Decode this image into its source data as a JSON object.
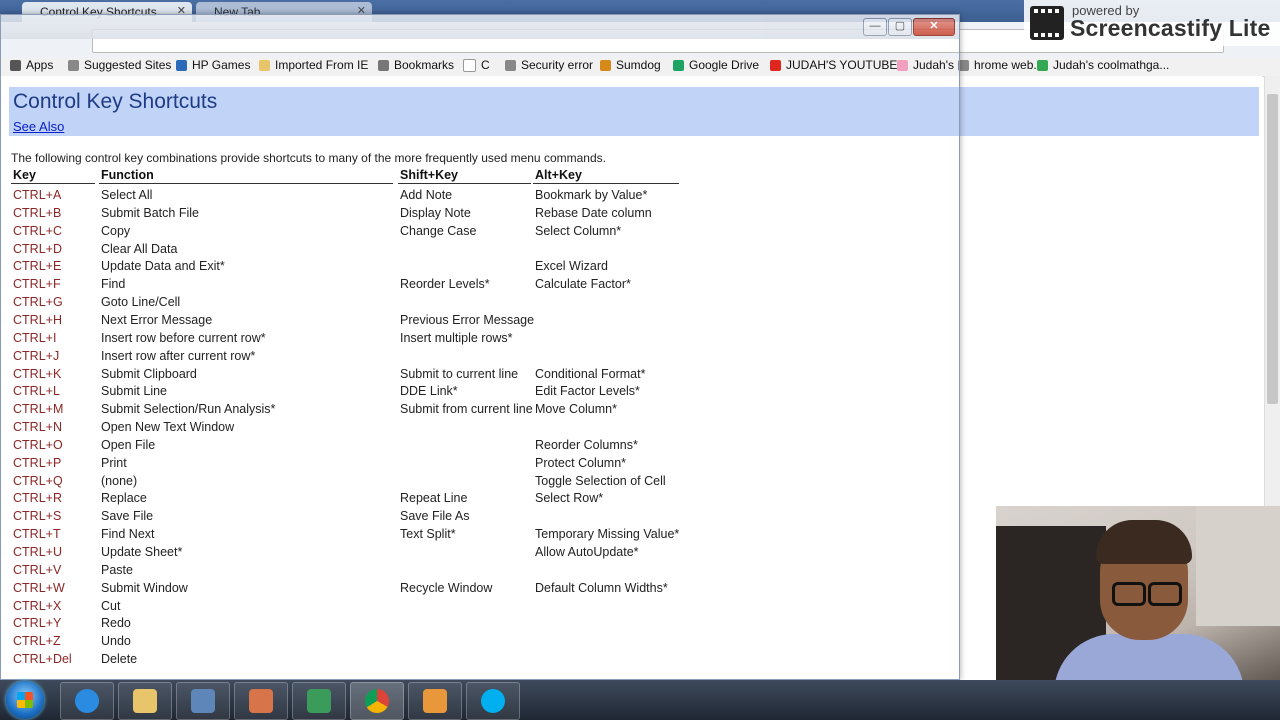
{
  "browser": {
    "active_tab_title": "Control Key Shortcuts",
    "new_tab_title": "New Tab",
    "bookmarks": [
      {
        "label": "Apps",
        "icon": "apps-grid-icon"
      },
      {
        "label": "Suggested Sites",
        "icon": "page-icon"
      },
      {
        "label": "HP Games",
        "icon": "hp-games-icon"
      },
      {
        "label": "Imported From IE",
        "icon": "folder-icon"
      },
      {
        "label": "Bookmarks",
        "icon": "star-icon"
      },
      {
        "label": "C",
        "icon": "page-icon"
      },
      {
        "label": "Security error",
        "icon": "page-icon"
      },
      {
        "label": "Sumdog",
        "icon": "sumdog-icon"
      },
      {
        "label": "Google Drive",
        "icon": "google-drive-icon"
      },
      {
        "label": "JUDAH'S YOUTUBE",
        "icon": "youtube-icon"
      },
      {
        "label": "Judah's",
        "icon": "rainbow-icon"
      },
      {
        "label": "hrome web...",
        "icon": "page-icon"
      },
      {
        "label": "Judah's coolmathga...",
        "icon": "chrome-web-icon"
      }
    ],
    "window_controls": {
      "minimize": "—",
      "maximize": "▢",
      "close": "✕"
    }
  },
  "watermark": {
    "powered_by": "powered by",
    "name": "Screencastify Lite"
  },
  "page": {
    "title": "Control Key Shortcuts",
    "see_also": "See Also",
    "intro": "The following control key combinations provide shortcuts to many of the more frequently used menu commands.",
    "columns": [
      "Key",
      "Function",
      "Shift+Key",
      "Alt+Key"
    ],
    "rows": [
      {
        "key": "CTRL+A",
        "fn": "Select All",
        "shift": "Add Note",
        "alt": "Bookmark by Value*"
      },
      {
        "key": "CTRL+B",
        "fn": "Submit Batch File",
        "shift": "Display Note",
        "alt": "Rebase Date column"
      },
      {
        "key": "CTRL+C",
        "fn": "Copy",
        "shift": "Change Case",
        "alt": "Select Column*"
      },
      {
        "key": "CTRL+D",
        "fn": "Clear All Data",
        "shift": "",
        "alt": ""
      },
      {
        "key": "CTRL+E",
        "fn": "Update Data and Exit*",
        "shift": "",
        "alt": "Excel Wizard"
      },
      {
        "key": "CTRL+F",
        "fn": "Find",
        "shift": "Reorder Levels*",
        "alt": "Calculate Factor*"
      },
      {
        "key": "CTRL+G",
        "fn": "Goto Line/Cell",
        "shift": "",
        "alt": ""
      },
      {
        "key": "CTRL+H",
        "fn": "Next Error Message",
        "shift": "Previous Error Message",
        "alt": ""
      },
      {
        "key": "CTRL+I",
        "fn": "Insert row before current row*",
        "shift": "Insert multiple rows*",
        "alt": ""
      },
      {
        "key": "CTRL+J",
        "fn": "Insert row after current row*",
        "shift": "",
        "alt": ""
      },
      {
        "key": "CTRL+K",
        "fn": "Submit Clipboard",
        "shift": "Submit to current line",
        "alt": "Conditional Format*"
      },
      {
        "key": "CTRL+L",
        "fn": "Submit Line",
        "shift": "DDE Link*",
        "alt": "Edit Factor Levels*"
      },
      {
        "key": "CTRL+M",
        "fn": "Submit Selection/Run Analysis*",
        "shift": "Submit from current line",
        "alt": "Move Column*"
      },
      {
        "key": "CTRL+N",
        "fn": "Open New Text Window",
        "shift": "",
        "alt": ""
      },
      {
        "key": "CTRL+O",
        "fn": "Open File",
        "shift": "",
        "alt": "Reorder Columns*"
      },
      {
        "key": "CTRL+P",
        "fn": "Print",
        "shift": "",
        "alt": "Protect Column*"
      },
      {
        "key": "CTRL+Q",
        "fn": "(none)",
        "shift": "",
        "alt": "Toggle Selection of Cell"
      },
      {
        "key": "CTRL+R",
        "fn": "Replace",
        "shift": "Repeat Line",
        "alt": "Select Row*"
      },
      {
        "key": "CTRL+S",
        "fn": "Save File",
        "shift": "Save File As",
        "alt": ""
      },
      {
        "key": "CTRL+T",
        "fn": "Find Next",
        "shift": "Text Split*",
        "alt": "Temporary Missing Value*"
      },
      {
        "key": "CTRL+U",
        "fn": "Update Sheet*",
        "shift": "",
        "alt": "Allow AutoUpdate*"
      },
      {
        "key": "CTRL+V",
        "fn": "Paste",
        "shift": "",
        "alt": ""
      },
      {
        "key": "CTRL+W",
        "fn": "Submit Window",
        "shift": "Recycle Window",
        "alt": "Default Column Widths*"
      },
      {
        "key": "CTRL+X",
        "fn": "Cut",
        "shift": "",
        "alt": ""
      },
      {
        "key": "CTRL+Y",
        "fn": "Redo",
        "shift": "",
        "alt": ""
      },
      {
        "key": "CTRL+Z",
        "fn": "Undo",
        "shift": "",
        "alt": ""
      },
      {
        "key": "CTRL+Del",
        "fn": "Delete",
        "shift": "",
        "alt": ""
      }
    ]
  },
  "taskbar": {
    "items": [
      "start-button",
      "internet-explorer-icon",
      "file-explorer-icon",
      "media-icon",
      "paint-icon",
      "hp-icon",
      "chrome-icon",
      "media-player-icon",
      "skype-icon"
    ]
  },
  "colors": {
    "header_band": "#c1d3f7",
    "title_text": "#1e3d86",
    "key_text": "#8c2626",
    "link": "#0a20c8"
  }
}
